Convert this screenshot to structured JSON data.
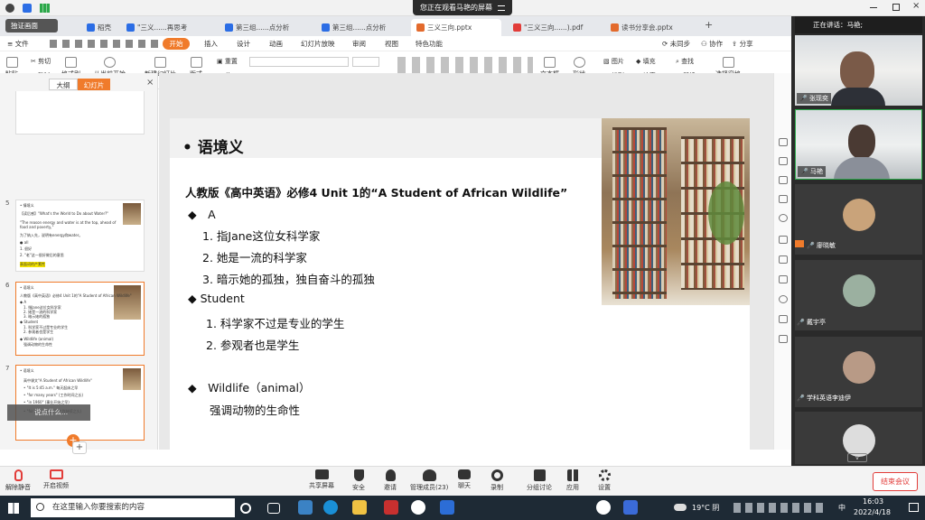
{
  "meeting": {
    "viewing_text": "您正在观看马艳的屏幕",
    "speaking": "正在讲话：马艳;",
    "end_label": "结束会议"
  },
  "wps": {
    "tabs": [
      {
        "label": "独证画面",
        "color": "#555"
      },
      {
        "label": "稻壳",
        "color": "#2b6de5"
      },
      {
        "label": "\"三义......再思考",
        "color": "#2b6de5"
      },
      {
        "label": "第三组......点分析",
        "color": "#2b6de5"
      },
      {
        "label": "第三组......点分析",
        "color": "#2b6de5"
      },
      {
        "label": "三义三向.pptx",
        "color": "#e36a2c"
      },
      {
        "label": "\"三义三向......).pdf",
        "color": "#e23c39"
      },
      {
        "label": "读书分享会.pptx",
        "color": "#e36a2c"
      }
    ],
    "menu": [
      "文件",
      "开始",
      "插入",
      "设计",
      "动画",
      "幻灯片放映",
      "审阅",
      "视图",
      "特色功能"
    ],
    "right_menu": [
      "未同步",
      "协作",
      "分享"
    ],
    "ribbon": {
      "paste": "粘贴",
      "cut": "剪切",
      "copy": "复制",
      "format_painter": "格式刷",
      "play_from_current": "从当前开始",
      "new_slide": "新建幻灯片",
      "layout": "版式",
      "section": "节",
      "reset": "重置",
      "textbox": "文本框",
      "shape": "形状",
      "picture": "图片",
      "fill": "填充",
      "arrange": "排列",
      "outline": "轮廓",
      "find": "查找",
      "replace": "替换",
      "select_pane": "选择窗格"
    },
    "panel_tabs": [
      "大纲",
      "幻灯片"
    ],
    "thumbs": [
      {
        "num": "5",
        "lines": [
          "• 情境义",
          "【读后感】\"What's the World to Do about Water?\"",
          "\"The reason energy and water is at the top, ahead of food and poverty,\"",
          "为了纳入先，说明有energy和water。",
          "● all",
          "1. 很好",
          "2. \"老\"这一很好做后的意思",
          "表面词的产素性"
        ]
      },
      {
        "num": "6",
        "lines": [
          "• 语境义",
          "人教版《高中英语》必修4 Unit 1的\"A Student of African Wildlife\"",
          "◆ A",
          "1. 指Jane这位女科学家",
          "2. 她是一流的科学家",
          "3. 暗示她的孤独",
          "◆ Student",
          "1. 科学家不过是专业的学生",
          "2. 参观者也是学生",
          "◆ Wildlife (animal)",
          "强调动物的生命性"
        ]
      },
      {
        "num": "7",
        "lines": [
          "• 语境义",
          "高中课文\"A Student of African Wildlife\"",
          "• \"It is 5:45 a.m.\" 每天起床之早",
          "• \"for many years\" (工作时间之长)",
          "• \"in 1960\" (事业开始之早)",
          "• \"for forty years\" (工作持续之久)"
        ]
      }
    ],
    "chat_hint": "说点什么...",
    "slide": {
      "heading": "• 语境义",
      "title": "人教版《高中英语》必修4 Unit 1的“A Student of African Wildlife”",
      "a_label": "◆　A",
      "a_items": [
        "1. 指Jane这位女科学家",
        "2. 她是一流的科学家",
        "3. 暗示她的孤独，独自奋斗的孤独"
      ],
      "s_label": "◆ Student",
      "s_items": [
        "1. 科学家不过是专业的学生",
        "2. 参观者也是学生"
      ],
      "w_label": "◆　Wildlife（animal）",
      "w_desc": "强调动物的生命性"
    }
  },
  "participants": [
    {
      "name": "张现奕",
      "type": "video"
    },
    {
      "name": "马艳",
      "type": "video"
    },
    {
      "name": "",
      "type": "avatar",
      "color": "#c9a37a"
    },
    {
      "name": "廖晓敏",
      "type": "label"
    },
    {
      "name": "",
      "type": "avatar",
      "color": "#9bb0a0"
    },
    {
      "name": "戴宇亭",
      "type": "label"
    },
    {
      "name": "",
      "type": "avatar",
      "color": "#b89a86"
    },
    {
      "name": "学科英语李迪伊",
      "type": "label"
    }
  ],
  "toolbar": {
    "left": [
      "解除静音",
      "开启视频"
    ],
    "center": [
      "共享屏幕",
      "安全",
      "邀请",
      "管理成员(23)",
      "聊天",
      "录制",
      "分组讨论",
      "应用",
      "设置"
    ]
  },
  "taskbar": {
    "search_placeholder": "在这里输入你要搜索的内容",
    "weather": "19°C 阴",
    "ime": "中",
    "time": "16:03",
    "date": "2022/4/18"
  }
}
